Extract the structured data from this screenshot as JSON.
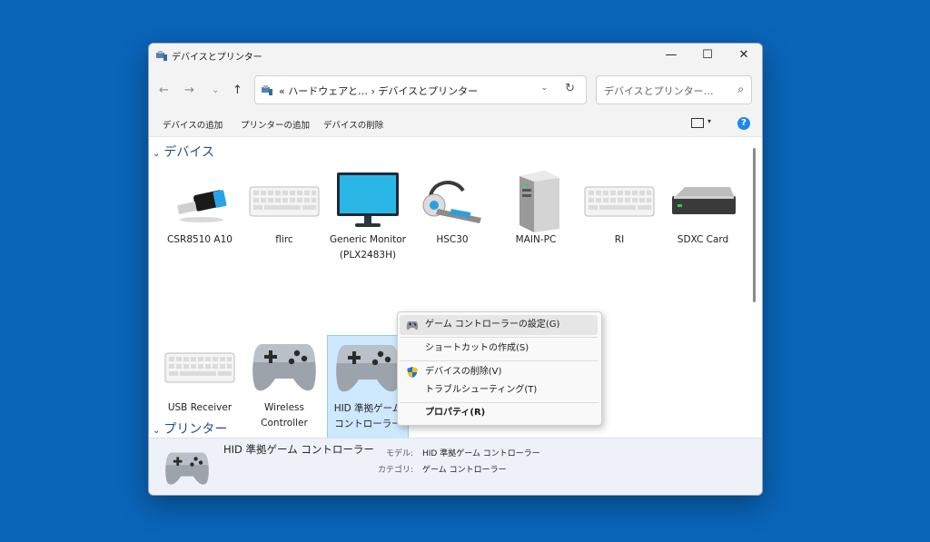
{
  "window": {
    "title": "デバイスとプリンター",
    "controls": {
      "minimize": "—",
      "maximize": "☐",
      "close": "✕"
    }
  },
  "nav": {
    "back": "←",
    "forward": "→",
    "recent": "⌄",
    "up": "↑",
    "address": "«  ハードウェアと…  ›  デバイスとプリンター",
    "address_dropdown": "⌄",
    "refresh": "↻",
    "search_placeholder": "デバイスとプリンター…",
    "search_icon": "⌕"
  },
  "commands": {
    "add_device": "デバイスの追加",
    "add_printer": "プリンターの追加",
    "remove_device": "デバイスの削除",
    "view_dropdown": "▾",
    "help": "?"
  },
  "groups": {
    "devices": "デバイス",
    "printers": "プリンター",
    "chevron": "⌄"
  },
  "devices": [
    {
      "label": "CSR8510 A10",
      "icon": "usb-dongle-icon"
    },
    {
      "label": "flirc",
      "icon": "keyboard-icon"
    },
    {
      "label": "Generic Monitor (PLX2483H)",
      "icon": "monitor-icon"
    },
    {
      "label": "HSC30",
      "icon": "headset-icon"
    },
    {
      "label": "MAIN-PC",
      "icon": "pc-tower-icon"
    },
    {
      "label": "RI",
      "icon": "keyboard-icon"
    },
    {
      "label": "SDXC Card",
      "icon": "drive-icon"
    },
    {
      "label": "USB Receiver",
      "icon": "keyboard-icon"
    },
    {
      "label": "Wireless Controller",
      "icon": "gamepad-icon"
    },
    {
      "label": "HID 準拠ゲーム コントローラー",
      "icon": "gamepad-icon",
      "selected": true
    }
  ],
  "context_menu": [
    {
      "label": "ゲーム コントローラーの設定(G)",
      "icon": "gamepad-small-icon",
      "highlighted": true
    },
    {
      "label": "ショートカットの作成(S)"
    },
    {
      "label": "デバイスの削除(V)",
      "icon": "shield-icon"
    },
    {
      "label": "トラブルシューティング(T)"
    },
    {
      "label": "プロパティ(R)",
      "bold": true
    }
  ],
  "details": {
    "name": "HID 準拠ゲーム コントローラー",
    "model_label": "モデル:",
    "model_value": "HID 準拠ゲーム コントローラー",
    "category_label": "カテゴリ:",
    "category_value": "ゲーム コントローラー"
  },
  "colors": {
    "desktop": "#0a64b8",
    "selection": "#cde8ff",
    "accent": "#1e88e5"
  }
}
